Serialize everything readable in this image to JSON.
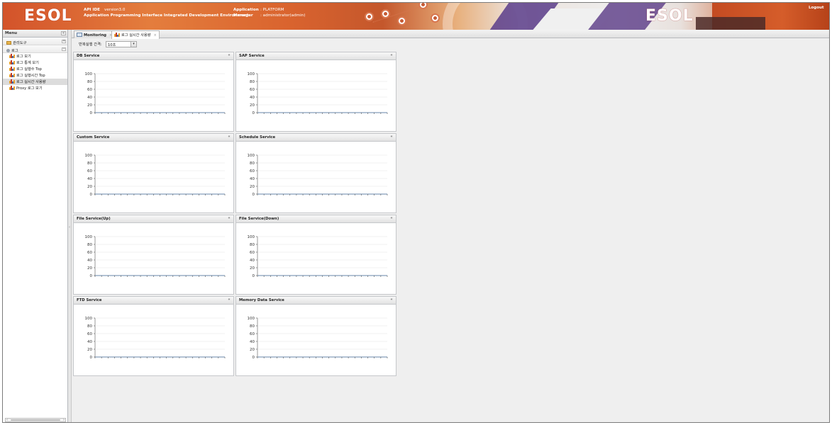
{
  "header": {
    "logo_left": "ESOL",
    "logo_right": "ESOL",
    "app_name": "API IDE",
    "version": "version3.0",
    "app_subtitle": "Application Programming Interface Integrated Development Environment",
    "application_label": "Application",
    "application_value": ": PLATFORM",
    "manager_label": "Manager",
    "manager_value": ": administrator(admin)",
    "logout_label": "Logout"
  },
  "sidebar": {
    "title": "Menu",
    "collapse_symbol": "«",
    "groups": [
      {
        "label": "관리도구",
        "toggle": "+"
      },
      {
        "label": "로그",
        "toggle": "−"
      }
    ],
    "items": [
      {
        "label": "로그 보기"
      },
      {
        "label": "로그 통계 보기"
      },
      {
        "label": "로그 실행수 Top"
      },
      {
        "label": "로그 실행시간 Top"
      },
      {
        "label": "로그 실시간 사용량",
        "selected": true
      },
      {
        "label": "Proxy 로그 보기"
      }
    ]
  },
  "tabs": [
    {
      "label": "Monitoring",
      "close": "×"
    },
    {
      "label": "로그 실시간 사용량",
      "close": "×",
      "active": true
    }
  ],
  "toolbar": {
    "interval_label": "반복실행 간격:",
    "interval_value": "10초"
  },
  "chart_data": [
    {
      "type": "line",
      "title": "DB Service",
      "ylim": [
        0,
        100
      ],
      "yticks": [
        "100",
        "80",
        "60",
        "40",
        "20",
        "0"
      ],
      "values": [
        0,
        0,
        0,
        0,
        0,
        0,
        0,
        0,
        0,
        0,
        0,
        0,
        0,
        0,
        0,
        0,
        0,
        0,
        0,
        0,
        0
      ]
    },
    {
      "type": "line",
      "title": "SAP Service",
      "ylim": [
        0,
        100
      ],
      "yticks": [
        "100",
        "80",
        "60",
        "40",
        "20",
        "0"
      ],
      "values": [
        0,
        0,
        0,
        0,
        0,
        0,
        0,
        0,
        0,
        0,
        0,
        0,
        0,
        0,
        0,
        0,
        0,
        0,
        0,
        0,
        0
      ]
    },
    {
      "type": "line",
      "title": "Custom Service",
      "ylim": [
        0,
        100
      ],
      "yticks": [
        "100",
        "80",
        "60",
        "40",
        "20",
        "0"
      ],
      "values": [
        0,
        0,
        0,
        0,
        0,
        0,
        0,
        0,
        0,
        0,
        0,
        0,
        0,
        0,
        0,
        0,
        0,
        0,
        0,
        0,
        0
      ]
    },
    {
      "type": "line",
      "title": "Schedule Service",
      "ylim": [
        0,
        100
      ],
      "yticks": [
        "100",
        "80",
        "60",
        "40",
        "20",
        "0"
      ],
      "values": [
        0,
        0,
        0,
        0,
        0,
        0,
        0,
        0,
        0,
        0,
        0,
        0,
        0,
        0,
        0,
        0,
        0,
        0,
        0,
        0,
        0
      ]
    },
    {
      "type": "line",
      "title": "File Service(Up)",
      "ylim": [
        0,
        100
      ],
      "yticks": [
        "100",
        "80",
        "60",
        "40",
        "20",
        "0"
      ],
      "values": [
        0,
        0,
        0,
        0,
        0,
        0,
        0,
        0,
        0,
        0,
        0,
        0,
        0,
        0,
        0,
        0,
        0,
        0,
        0,
        0,
        0
      ]
    },
    {
      "type": "line",
      "title": "File Service(Down)",
      "ylim": [
        0,
        100
      ],
      "yticks": [
        "100",
        "80",
        "60",
        "40",
        "20",
        "0"
      ],
      "values": [
        0,
        0,
        0,
        0,
        0,
        0,
        0,
        0,
        0,
        0,
        0,
        0,
        0,
        0,
        0,
        0,
        0,
        0,
        0,
        0,
        0
      ]
    },
    {
      "type": "line",
      "title": "FTD Service",
      "ylim": [
        0,
        100
      ],
      "yticks": [
        "100",
        "80",
        "60",
        "40",
        "20",
        "0"
      ],
      "values": [
        0,
        0,
        0,
        0,
        0,
        0,
        0,
        0,
        0,
        0,
        0,
        0,
        0,
        0,
        0,
        0,
        0,
        0,
        0,
        0,
        0
      ]
    },
    {
      "type": "line",
      "title": "Memory Data Service",
      "ylim": [
        0,
        100
      ],
      "yticks": [
        "100",
        "80",
        "60",
        "40",
        "20",
        "0"
      ],
      "values": [
        0,
        0,
        0,
        0,
        0,
        0,
        0,
        0,
        0,
        0,
        0,
        0,
        0,
        0,
        0,
        0,
        0,
        0,
        0,
        0,
        0
      ]
    }
  ],
  "panel_toggle_symbol": "«",
  "colors": {
    "header_accent": "#d3532a",
    "bar_orange": "#e8a030",
    "bar_red": "#c0392b",
    "bar_blue": "#3a6fb0",
    "series_line": "#5c88b8"
  },
  "icons": {
    "monitoring_tab": "monitor-icon",
    "log_items": "bar-chart-icon",
    "admin_group": "folder-icon"
  }
}
